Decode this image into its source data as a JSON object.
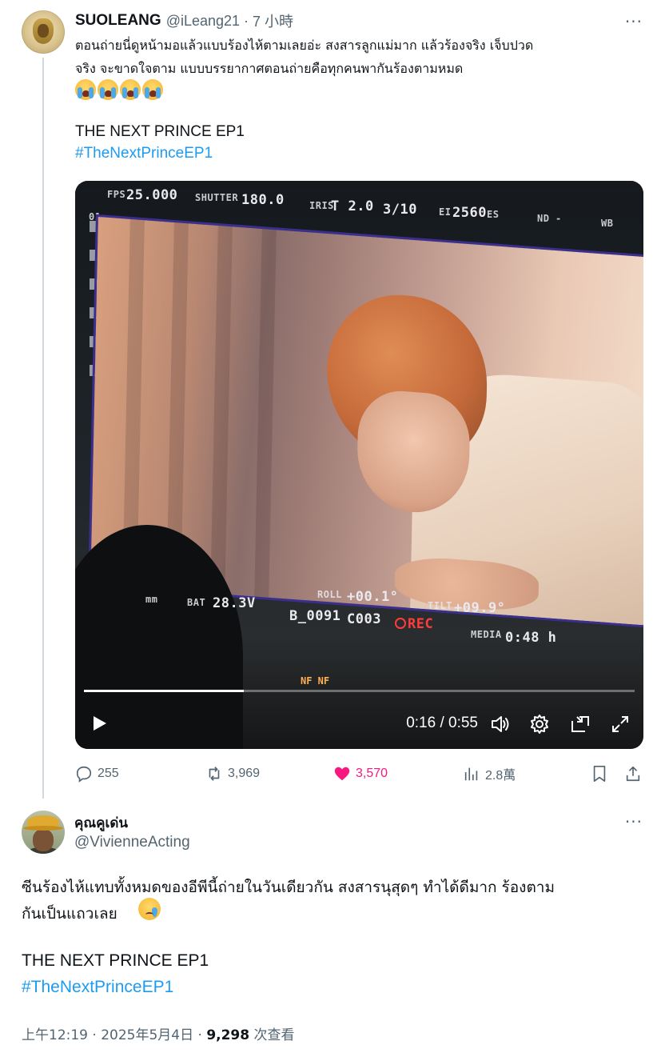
{
  "tweet1": {
    "display_name": "SUOLEANG",
    "handle": "@iLeang21",
    "separator": "·",
    "time_ago": "7 小時",
    "more": "···",
    "text_line1": "ตอนถ่ายนี่ดูหน้ามอแล้วแบบร้องไห้ตามเลยอ่ะ สงสารลูกแม่มาก แล้วร้องจริง เจ็บปวด",
    "text_line2": "จริง จะขาดใจตาม แบบบรรยากาศตอนถ่ายคือทุกคนพากันร้องตามหมด",
    "emojis": [
      "loudly-crying-face",
      "loudly-crying-face",
      "loudly-crying-face",
      "loudly-crying-face"
    ],
    "show_title": "THE NEXT PRINCE EP1",
    "hashtag": "#TheNextPrinceEP1",
    "video": {
      "hud": {
        "fps_label": "FPS",
        "fps_value": "25.000",
        "shutter_label": "SHUTTER",
        "shutter_value": "180.0",
        "iris_label": "IRIS",
        "iris_value": "T 2.0",
        "fraction": "3/10",
        "ei_label": "EI",
        "ei_value": "2560",
        "ei_suffix": "ES",
        "nd_label": "ND",
        "nd_value": "-",
        "wb_label": "WB",
        "mm": "mm",
        "bat_label": "BAT",
        "bat_value": "28.3V",
        "roll_label": "ROLL",
        "roll_value": "+00.1°",
        "clip": "B_0091",
        "clip2": "C003",
        "rec": "REC",
        "tilt_label": "TILT",
        "tilt_value": "+09.9°",
        "media_label": "MEDIA",
        "media_value": "0:48 h",
        "side_mark": "01",
        "tally": "NF NF"
      },
      "current_time": "0:16",
      "duration": "0:55",
      "time_separator": " / ",
      "progress_fraction": 0.29
    },
    "actions": {
      "replies": "255",
      "reposts": "3,969",
      "likes": "3,570",
      "views": "2.8萬"
    },
    "colors": {
      "like": "#f91880",
      "link": "#1d9bf0",
      "muted": "#536471"
    }
  },
  "tweet2": {
    "display_name": "คุณคูเด่น",
    "handle": "@VivienneActing",
    "more": "···",
    "text_line1": "ซีนร้องไห้แทบทั้งหมดของอีพีนี้ถ่ายในวันเดียวกัน สงสารนุสุดๆ ทำได้ดีมาก ร้องตาม",
    "text_line2": "กันเป็นแถวเลย",
    "emoji": "crying-face",
    "show_title": "THE NEXT PRINCE EP1",
    "hashtag": "#TheNextPrinceEP1",
    "timestamp": "上午12:19 · 2025年5月4日 · ",
    "views_count": "9,298",
    "views_label": " 次查看"
  }
}
